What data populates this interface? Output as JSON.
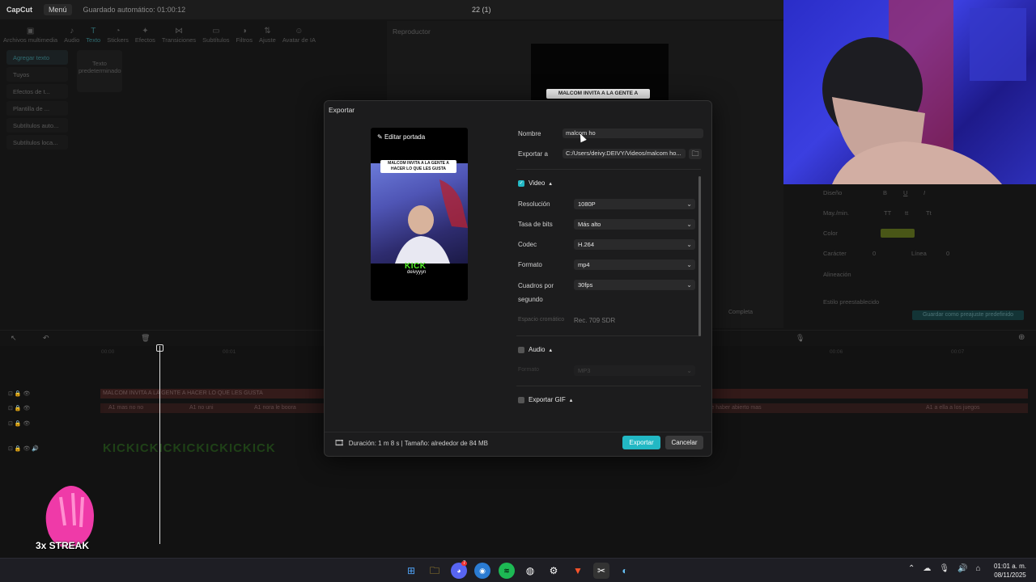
{
  "app": {
    "logo": "CapCut",
    "menu_label": "Menú",
    "autosave": "Guardado automático: 01:00:12",
    "project_title": "22 (1)"
  },
  "tools": [
    {
      "label": "Archivos multimedia",
      "icon": "media-icon"
    },
    {
      "label": "Audio",
      "icon": "audio-icon"
    },
    {
      "label": "Texto",
      "icon": "text-icon"
    },
    {
      "label": "Stickers",
      "icon": "sticker-icon"
    },
    {
      "label": "Efectos",
      "icon": "effects-icon"
    },
    {
      "label": "Transiciones",
      "icon": "transitions-icon"
    },
    {
      "label": "Subtítulos",
      "icon": "subtitles-icon"
    },
    {
      "label": "Filtros",
      "icon": "filters-icon"
    },
    {
      "label": "Ajuste",
      "icon": "adjust-icon"
    },
    {
      "label": "Avatar de IA",
      "icon": "avatar-icon"
    }
  ],
  "leftnav": {
    "items": [
      "Agregar texto",
      "Tuyos",
      "Efectos de t...",
      "Plantilla de ...",
      "Subtítulos auto...",
      "Subtítulos loca..."
    ],
    "card": "Texto predeterminado"
  },
  "player": {
    "label": "Reproductor",
    "caption": "MALCOM INVITA A LA GENTE A"
  },
  "props": {
    "diseno": "Diseño",
    "mayus": "May./min.",
    "mayus_opts": [
      "TT",
      "tt",
      "Tt"
    ],
    "color": "Color",
    "caracter": "Carácter",
    "caracter_val": "0",
    "linea": "Línea",
    "linea_val": "0",
    "alineacion": "Alineación",
    "estilo": "Estilo preestablecido",
    "save_preset": "Guardar como preajuste predefinido",
    "completa": "Completa"
  },
  "timeline": {
    "ticks": [
      "00:00",
      "00:01",
      "00:06",
      "00:07"
    ],
    "text_track": "MALCOM INVITA A LA GENTE A HACER LO QUE LES GUSTA",
    "sub_track": [
      "A1  mas no no",
      "A1  no uni",
      "A1  nora le boora",
      "A1  de haber abierto mas",
      "A1  a ella a los juegos"
    ],
    "kick_track": "KICKICKICKICKICKICKICK"
  },
  "overlay": {
    "streak": "3x STREAK"
  },
  "dialog": {
    "title": "Exportar",
    "cover_edit": "Editar portada",
    "cover_caption": "MALCOM INVITA A LA GENTE A HACER LO QUE LES GUSTA",
    "cover_kick": "KICK",
    "cover_user": "deivyyyn",
    "name_label": "Nombre",
    "name_value": "malcom ho",
    "export_to_label": "Exportar a",
    "export_to_value": "C:/Users/deivy.DEIVY/Videos/malcom ho...",
    "video_section": "Video",
    "resolution_label": "Resolución",
    "resolution_value": "1080P",
    "bitrate_label": "Tasa de bits",
    "bitrate_value": "Más alto",
    "codec_label": "Codec",
    "codec_value": "H.264",
    "format_label": "Formato",
    "format_value": "mp4",
    "fps_label_1": "Cuadros por",
    "fps_label_2": "segundo",
    "fps_value": "30fps",
    "colorspace_label": "Espacio cromático",
    "colorspace_value": "Rec. 709 SDR",
    "audio_section": "Audio",
    "audio_format_label": "Formato",
    "audio_format_value": "MP3",
    "gif_section": "Exportar GIF",
    "duration": "Duración: 1 m 8 s | Tamaño: alrededor de 84 MB",
    "export_btn": "Exportar",
    "cancel_btn": "Cancelar"
  },
  "taskbar": {
    "time": "01:01 a. m.",
    "date": "08/11/2025",
    "discord_badge": "7"
  }
}
